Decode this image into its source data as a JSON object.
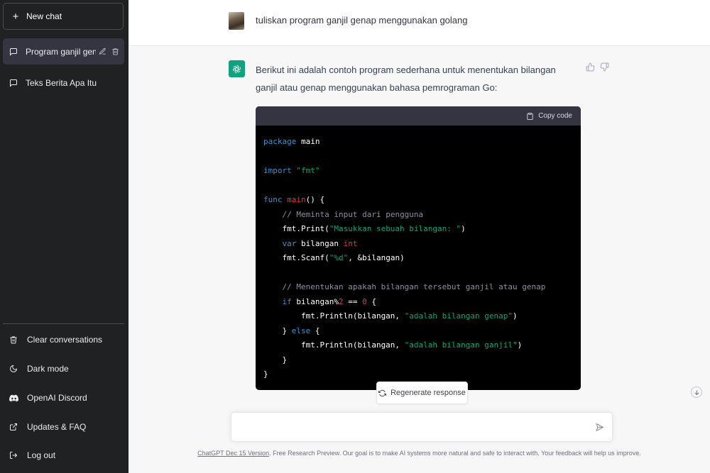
{
  "sidebar": {
    "new_chat": "New chat",
    "conversations": [
      {
        "label": "Program ganjil genap",
        "active": true
      },
      {
        "label": "Teks Berita Apa Itu",
        "active": false
      }
    ],
    "bottom": {
      "clear": "Clear conversations",
      "dark": "Dark mode",
      "discord": "OpenAI Discord",
      "updates": "Updates & FAQ",
      "logout": "Log out"
    }
  },
  "chat": {
    "user_message": "tuliskan program ganjil genap menggunakan golang",
    "assistant_intro": "Berikut ini adalah contoh program sederhana untuk menentukan bilangan ganjil atau genap menggunakan bahasa pemrograman Go:",
    "copy_code": "Copy code",
    "regenerate": "Regenerate response",
    "input_placeholder": ""
  },
  "footer": {
    "version_link": "ChatGPT Dec 15 Version",
    "text": ". Free Research Preview. Our goal is to make AI systems more natural and safe to interact with. Your feedback will help us improve."
  },
  "colors": {
    "sidebar_bg": "#202123",
    "accent": "#10a37f",
    "code_bg": "#000000"
  }
}
